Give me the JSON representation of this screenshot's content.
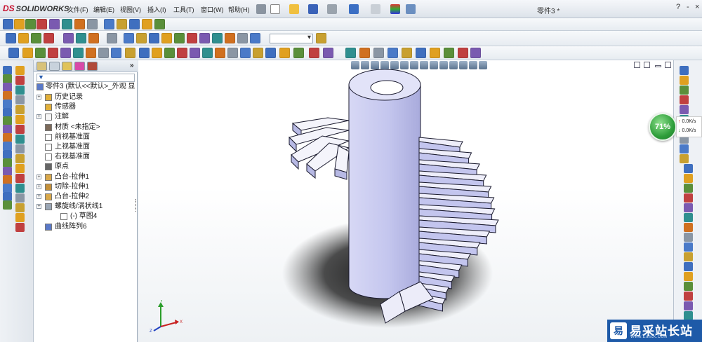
{
  "app": {
    "brand": "SOLIDWORKS",
    "document_title": "零件3 *",
    "menu": [
      "文件(F)",
      "编辑(E)",
      "视图(V)",
      "插入(I)",
      "工具(T)",
      "窗口(W)",
      "帮助(H)"
    ],
    "window_controls": [
      "?",
      "-",
      "□",
      "×"
    ]
  },
  "tree": {
    "root_label": "零件3 (默认<<默认>_外观 显",
    "items": [
      {
        "label": "历史记录",
        "icon": "folder-icon",
        "expandable": true
      },
      {
        "label": "传感器",
        "icon": "folder-icon",
        "expandable": false
      },
      {
        "label": "注解",
        "icon": "annotation-icon",
        "expandable": true
      },
      {
        "label": "材质 <未指定>",
        "icon": "material-icon",
        "expandable": false
      },
      {
        "label": "前视基准面",
        "icon": "plane-icon",
        "expandable": false
      },
      {
        "label": "上视基准面",
        "icon": "plane-icon",
        "expandable": false
      },
      {
        "label": "右视基准面",
        "icon": "plane-icon",
        "expandable": false
      },
      {
        "label": "原点",
        "icon": "origin-icon",
        "expandable": false
      },
      {
        "label": "凸台-拉伸1",
        "icon": "extrude-icon",
        "expandable": true
      },
      {
        "label": "切除-拉伸1",
        "icon": "cut-icon",
        "expandable": true
      },
      {
        "label": "凸台-拉伸2",
        "icon": "extrude-icon",
        "expandable": true
      },
      {
        "label": "螺旋线/涡状线1",
        "icon": "helix-icon",
        "expandable": true
      },
      {
        "label": "(-) 草图4",
        "icon": "sketch-icon",
        "expandable": false,
        "indent": true
      },
      {
        "label": "曲线阵列6",
        "icon": "pattern-icon",
        "expandable": false
      }
    ]
  },
  "status": {
    "performance_percent": "71%",
    "upload_rate": "0.0K/s",
    "download_rate": "0.0K/s"
  },
  "watermark": {
    "logo": "易",
    "text": "易采站长站",
    "subtext": "Www.Easck.Com"
  },
  "colors": {
    "accent": "#c8102e",
    "gauge": "#2f9e3a",
    "model": "#c9cbf0",
    "watermark": "#1e5aa8"
  }
}
